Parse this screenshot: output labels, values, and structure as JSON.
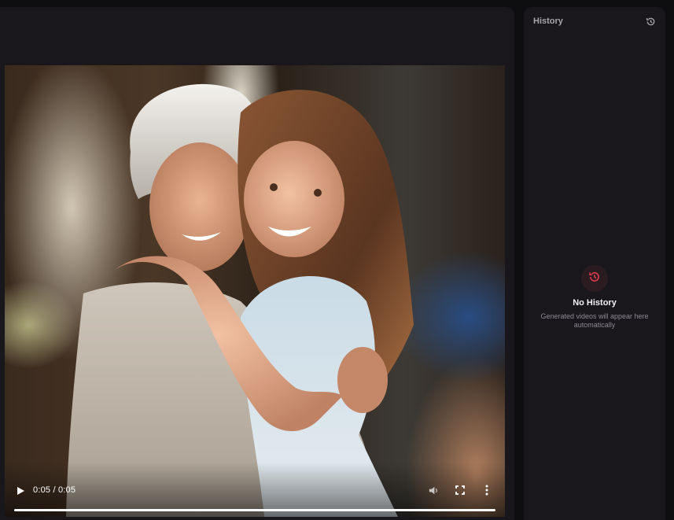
{
  "player": {
    "time_display": "0:05 / 0:05",
    "progress_fraction": 1.0,
    "icons": {
      "play": "play-icon",
      "mute": "volume-icon",
      "fullscreen": "fullscreen-icon",
      "more": "more-vertical-icon"
    }
  },
  "history": {
    "title": "History",
    "header_icon": "history-icon",
    "empty_icon": "history-icon",
    "empty_title": "No History",
    "empty_description": "Generated videos will appear here automatically",
    "accent_color": "#d23a4a"
  }
}
